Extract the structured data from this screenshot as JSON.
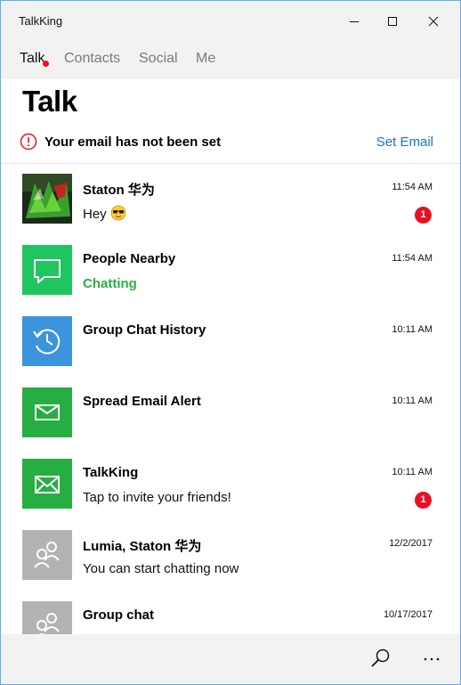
{
  "window": {
    "title": "TalkKing"
  },
  "nav": {
    "tabs": [
      {
        "label": "Talk",
        "active": true,
        "unread": true
      },
      {
        "label": "Contacts",
        "active": false
      },
      {
        "label": "Social",
        "active": false
      },
      {
        "label": "Me",
        "active": false
      }
    ]
  },
  "page": {
    "title": "Talk"
  },
  "notice": {
    "text": "Your email has not been set",
    "link": "Set Email",
    "icon": "alert-circle-icon",
    "color": "#e81123"
  },
  "chats": [
    {
      "name": "Staton 华为",
      "time": "11:54 AM",
      "preview": "Hey",
      "preview_emoji": "sunglasses-emoji",
      "badge": "1",
      "avatar": "photo-avatar"
    },
    {
      "name": "People Nearby",
      "time": "11:54 AM",
      "preview": "Chatting",
      "preview_style": "status",
      "avatar": "chat-bubble-icon",
      "avatar_color": "#1fc65f"
    },
    {
      "name": "Group Chat History",
      "time": "10:11 AM",
      "preview": "",
      "avatar": "history-icon",
      "avatar_color": "#3c94dc"
    },
    {
      "name": "Spread Email Alert",
      "time": "10:11 AM",
      "preview": "",
      "avatar": "mail-icon",
      "avatar_color": "#26ae42"
    },
    {
      "name": "TalkKing",
      "time": "10:11 AM",
      "preview": "Tap to invite your friends!",
      "badge": "1",
      "avatar": "mail-open-icon",
      "avatar_color": "#26ae42"
    },
    {
      "name": "Lumia, Staton 华为",
      "time": "12/2/2017",
      "preview": "You can start chatting now",
      "avatar": "group-icon",
      "avatar_color": "#b3b3b3"
    },
    {
      "name": "Group chat",
      "time": "10/17/2017",
      "preview": "",
      "avatar": "group-icon",
      "avatar_color": "#b3b3b3"
    }
  ],
  "bottom": {
    "search_icon": "search-icon",
    "more_icon": "more-icon"
  },
  "colors": {
    "accent": "#1a73c7",
    "badge": "#e81123",
    "status_green": "#2ab042",
    "chrome": "#f2f2f2"
  }
}
